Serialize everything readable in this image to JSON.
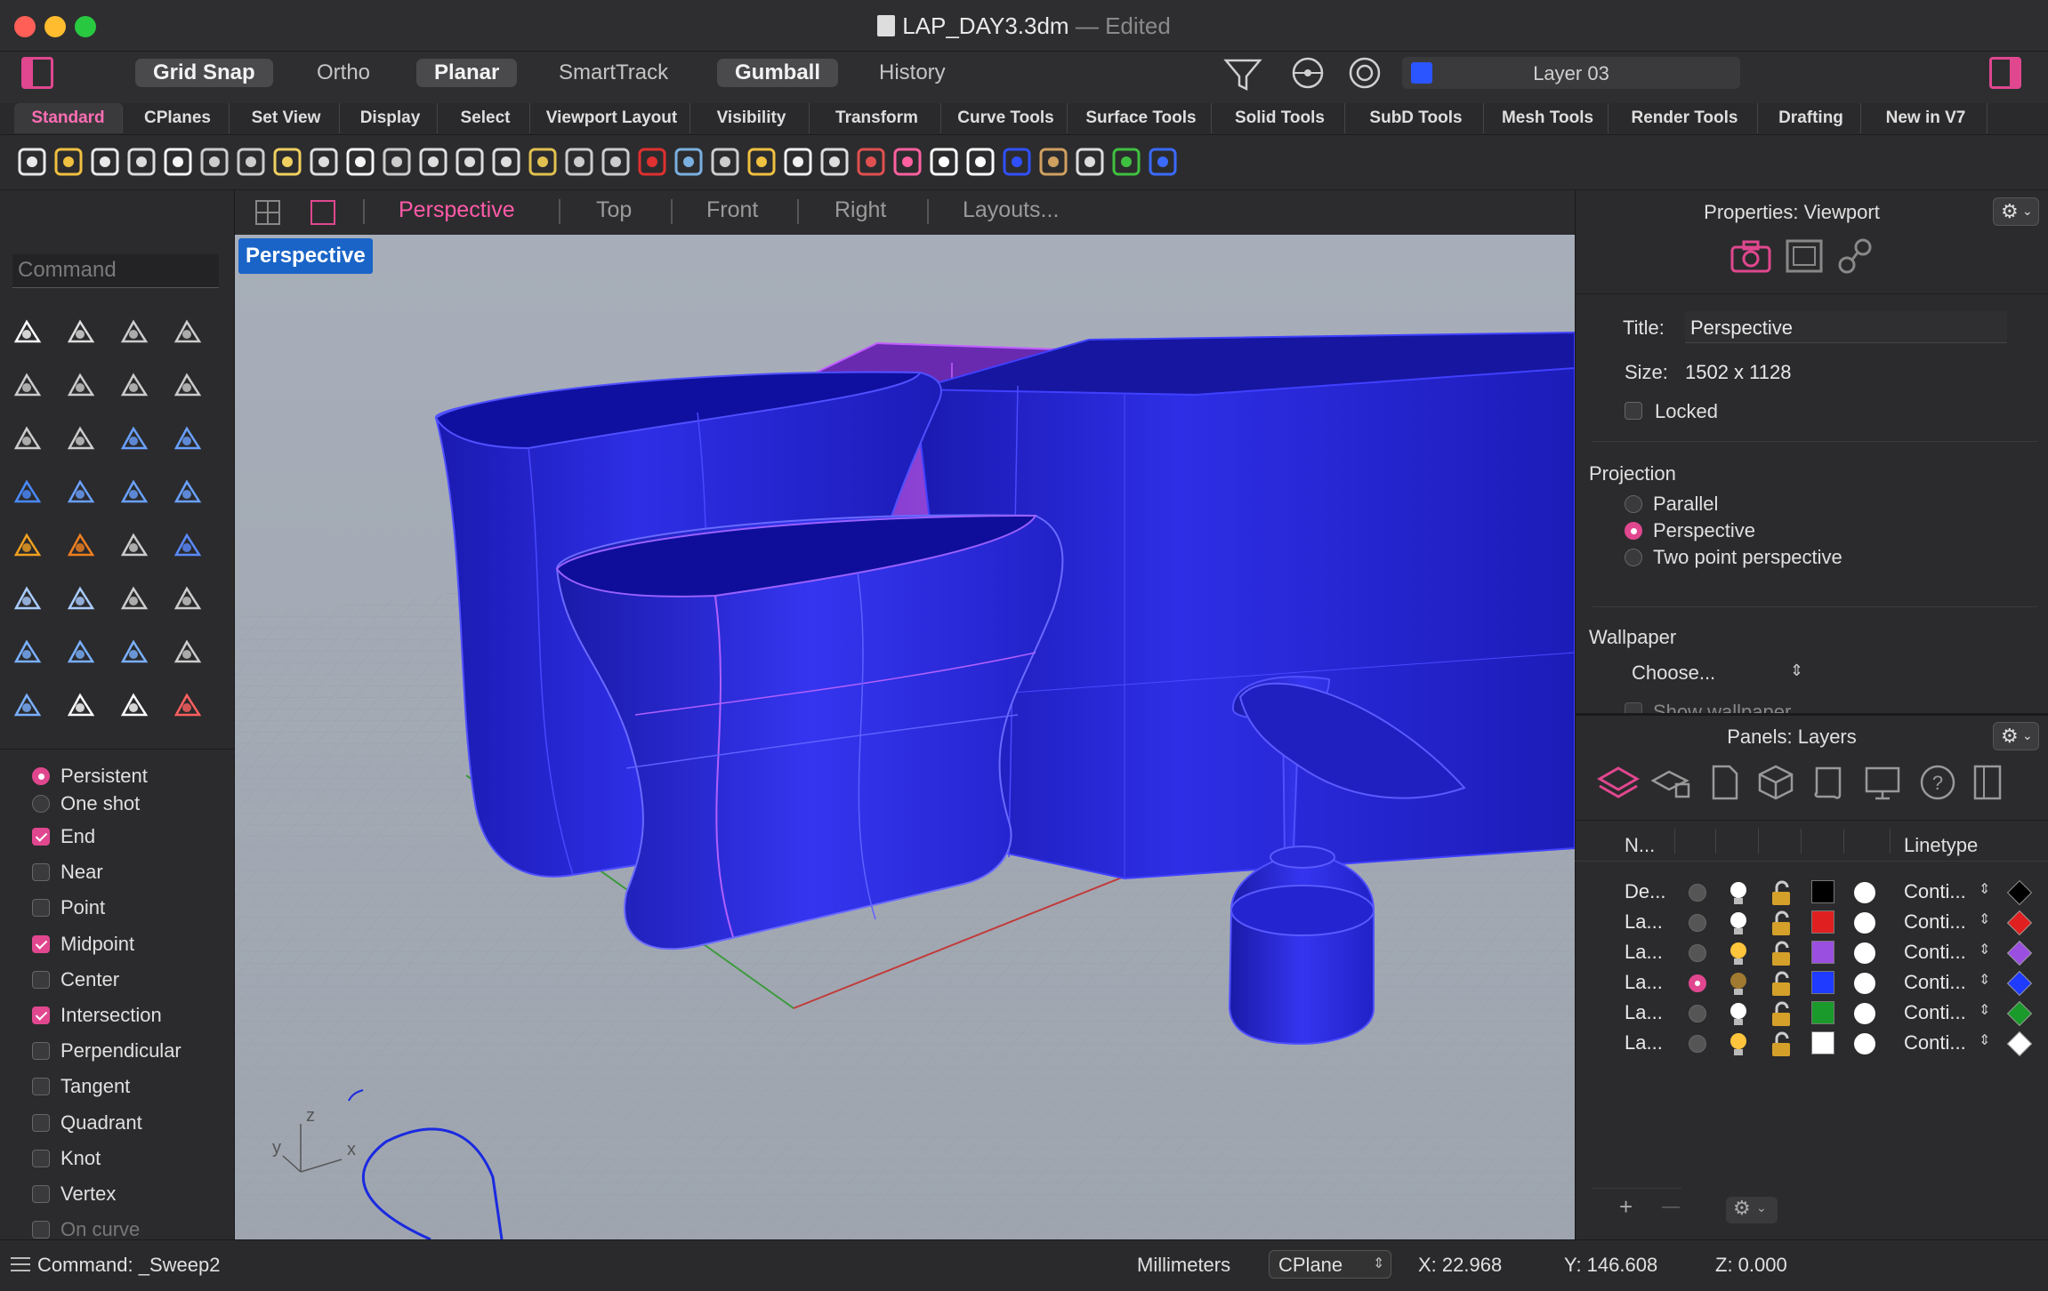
{
  "window": {
    "filename": "LAP_DAY3.3dm",
    "separator": "—",
    "status": "Edited"
  },
  "modes": [
    {
      "label": "Grid Snap",
      "on": true
    },
    {
      "label": "Ortho",
      "on": false
    },
    {
      "label": "Planar",
      "on": true
    },
    {
      "label": "SmartTrack",
      "on": false
    },
    {
      "label": "Gumball",
      "on": true
    },
    {
      "label": "History",
      "on": false
    }
  ],
  "current_layer": {
    "name": "Layer 03",
    "color": "#2b55ff"
  },
  "tabs": [
    "Standard",
    "CPlanes",
    "Set View",
    "Display",
    "Select",
    "Viewport Layout",
    "Visibility",
    "Transform",
    "Curve Tools",
    "Surface Tools",
    "Solid Tools",
    "SubD Tools",
    "Mesh Tools",
    "Render Tools",
    "Drafting",
    "New in V7"
  ],
  "active_tab": "Standard",
  "toolbar_icons": [
    "new-file-icon",
    "open-folder-icon",
    "save-icon",
    "print-icon",
    "import-icon",
    "cut-icon",
    "copy-icon",
    "paste-icon",
    "undo-icon",
    "pan-hand-icon",
    "rotate-view-icon",
    "zoom-icon",
    "zoom-window-icon",
    "zoom-extents-icon",
    "zoom-selected-icon",
    "rotate-camera-icon",
    "four-viewports-icon",
    "car-render-icon",
    "grid-plane-icon",
    "cplane-icon",
    "points-icon",
    "light-icon",
    "lock-icon",
    "material-icon",
    "color-wheel-icon",
    "sphere-wire-icon",
    "sphere-shaded-icon",
    "sphere-rendered-icon",
    "sphere-gradient-icon",
    "dimension-icon",
    "globe-icon",
    "help-icon"
  ],
  "command": {
    "placeholder": "Command"
  },
  "osnaps": {
    "mode": [
      {
        "label": "Persistent",
        "on": true
      },
      {
        "label": "One shot",
        "on": false
      }
    ],
    "items": [
      {
        "label": "End",
        "on": true
      },
      {
        "label": "Near",
        "on": false
      },
      {
        "label": "Point",
        "on": false
      },
      {
        "label": "Midpoint",
        "on": true
      },
      {
        "label": "Center",
        "on": false
      },
      {
        "label": "Intersection",
        "on": true
      },
      {
        "label": "Perpendicular",
        "on": false
      },
      {
        "label": "Tangent",
        "on": false
      },
      {
        "label": "Quadrant",
        "on": false
      },
      {
        "label": "Knot",
        "on": false
      },
      {
        "label": "Vertex",
        "on": false
      },
      {
        "label": "On curve",
        "on": false
      }
    ]
  },
  "viewport_tabs": [
    {
      "label": "Perspective",
      "on": true
    },
    {
      "label": "Top",
      "on": false
    },
    {
      "label": "Front",
      "on": false
    },
    {
      "label": "Right",
      "on": false
    },
    {
      "label": "Layouts...",
      "on": false
    }
  ],
  "viewport": {
    "label": "Perspective",
    "axes": {
      "x": "x",
      "y": "y",
      "z": "z"
    }
  },
  "properties": {
    "title": "Properties: Viewport",
    "title_label": "Title:",
    "title_value": "Perspective",
    "size_label": "Size:",
    "size_value": "1502 x 1128",
    "locked_label": "Locked",
    "projection_header": "Projection",
    "projection_options": [
      {
        "label": "Parallel",
        "on": false
      },
      {
        "label": "Perspective",
        "on": true
      },
      {
        "label": "Two point perspective",
        "on": false
      }
    ],
    "wallpaper_header": "Wallpaper",
    "wallpaper_choose": "Choose...",
    "wallpaper_show": "Show wallpaper"
  },
  "layers": {
    "title": "Panels: Layers",
    "col_name": "N...",
    "col_linetype": "Linetype",
    "rows": [
      {
        "name": "De...",
        "current": false,
        "bulb": "#ffffff",
        "color": "#000000",
        "linetype": "Conti...",
        "material": "#000000"
      },
      {
        "name": "La...",
        "current": false,
        "bulb": "#ffffff",
        "color": "#e02020",
        "linetype": "Conti...",
        "material": "#e02020"
      },
      {
        "name": "La...",
        "current": false,
        "bulb": "#ffc53d",
        "color": "#9b4fe0",
        "linetype": "Conti...",
        "material": "#9b4fe0"
      },
      {
        "name": "La...",
        "current": true,
        "bulb": "#a07a30",
        "color": "#1f3bff",
        "linetype": "Conti...",
        "material": "#1f3bff"
      },
      {
        "name": "La...",
        "current": false,
        "bulb": "#ffffff",
        "color": "#1a9a2a",
        "linetype": "Conti...",
        "material": "#1a9a2a"
      },
      {
        "name": "La...",
        "current": false,
        "bulb": "#ffc53d",
        "color": "#ffffff",
        "linetype": "Conti...",
        "material": "#ffffff"
      }
    ],
    "add": "+",
    "remove": "—"
  },
  "status": {
    "command": "Command: _Sweep2",
    "units": "Millimeters",
    "cplane": "CPlane",
    "x": "X: 22.968",
    "y": "Y: 146.608",
    "z": "Z: 0.000"
  },
  "colors": {
    "accent": "#ff5aa8",
    "selection": "#1a64c8",
    "object_blue": "#2b2bd8",
    "object_purple": "#8b3fd0"
  }
}
